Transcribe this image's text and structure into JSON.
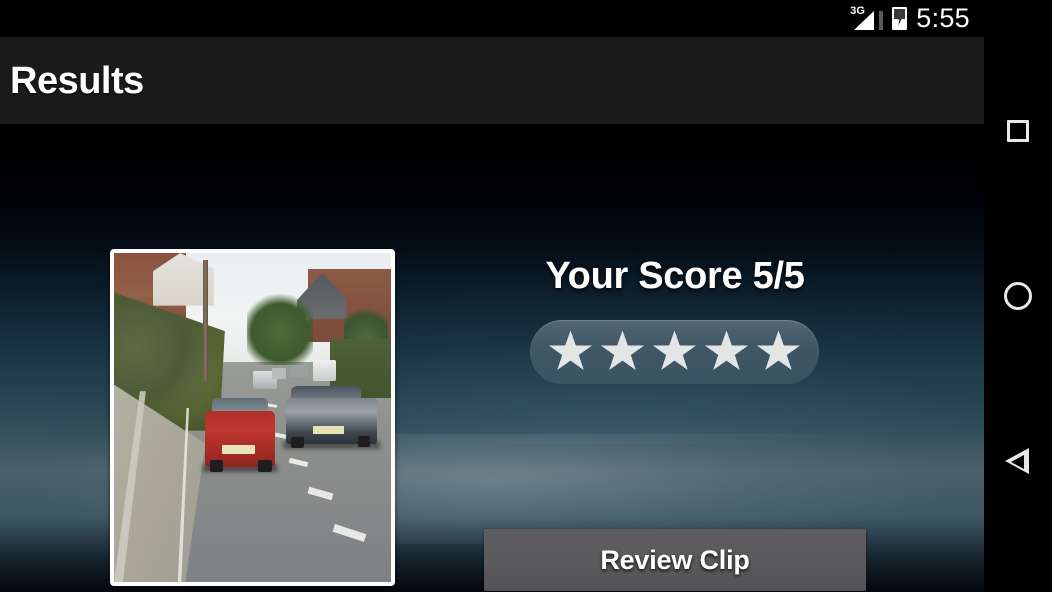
{
  "status_bar": {
    "network_label": "3G",
    "battery_state": "charging",
    "time": "5:55"
  },
  "action_bar": {
    "title": "Results"
  },
  "content": {
    "score_text": "Your Score 5/5",
    "score_value": 5,
    "score_max": 5,
    "stars_filled": 5,
    "clip_thumbnail_alt": "Dashcam clip thumbnail showing a residential road with a red car ahead and a silver car parked on the right",
    "review_button_label": "Review Clip"
  },
  "nav_bar": {
    "recent_label": "Recent apps",
    "home_label": "Home",
    "back_label": "Back"
  },
  "colors": {
    "status_bar_bg": "#000000",
    "action_bar_bg": "#1b1b1b",
    "button_bg": "#5a5a5c",
    "star_fill": "#e3e5e6",
    "text_primary": "#ffffff"
  }
}
